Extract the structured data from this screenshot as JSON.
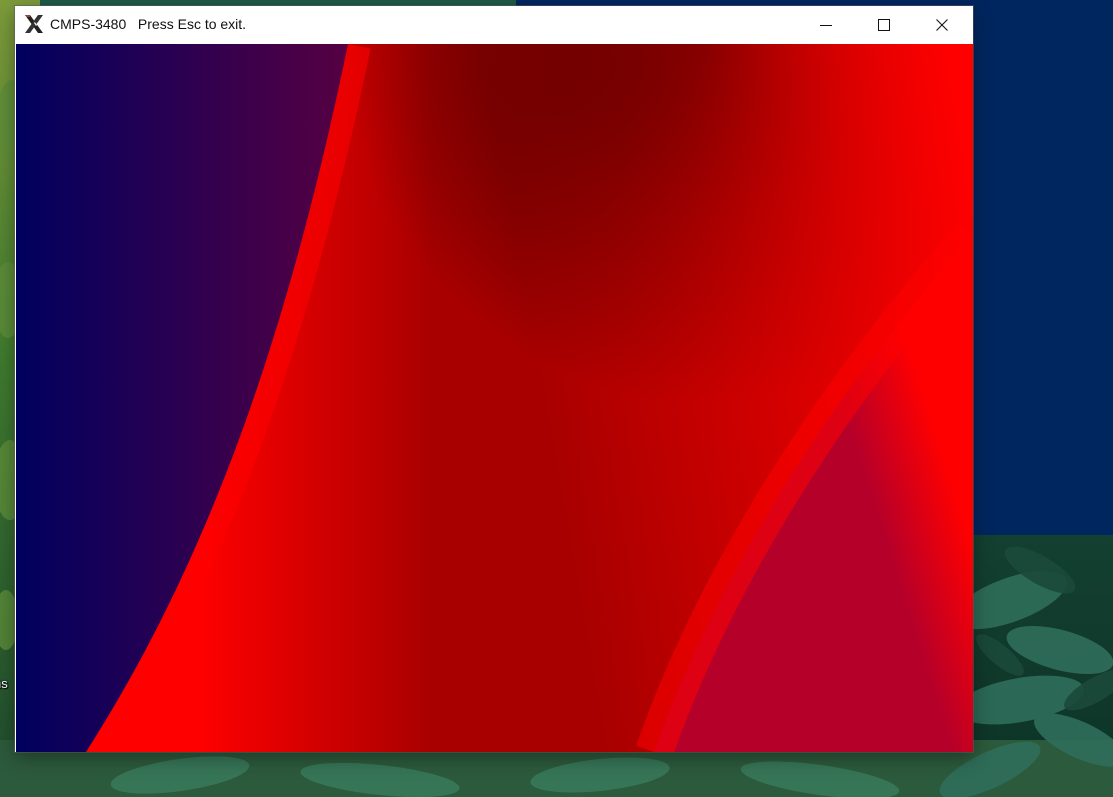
{
  "window": {
    "title": "CMPS-3480   Press Esc to exit.",
    "app_icon": "x11-icon",
    "controls": {
      "minimize_icon": "minimize-icon",
      "maximize_icon": "maximize-icon",
      "close_icon": "close-icon"
    }
  },
  "desktop": {
    "icon_label_fragment": "ns"
  },
  "canvas": {
    "colors": {
      "left_region_start": "#00005e",
      "left_region_end": "#560043",
      "bright_red": "#ff0000",
      "dark_red": "#a80000",
      "near_black": "#1a0000",
      "crimson": "#b5002a"
    }
  }
}
